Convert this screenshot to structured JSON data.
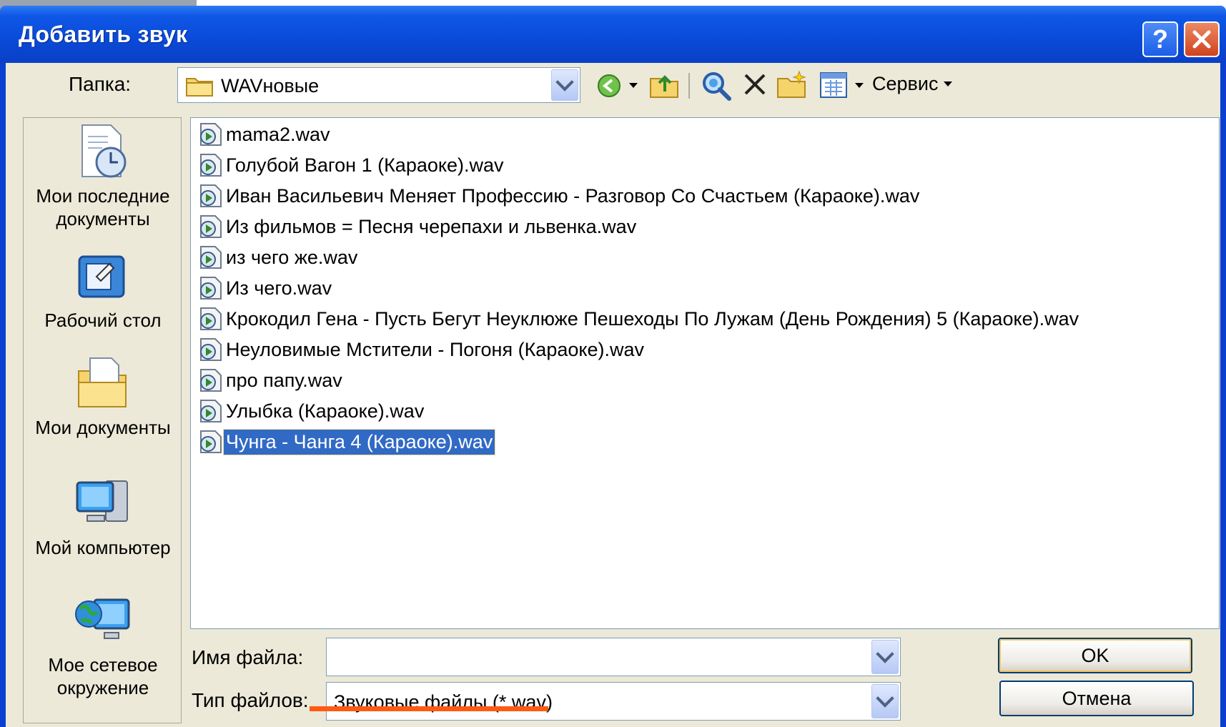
{
  "dialog": {
    "title": "Добавить звук",
    "help_label": "?",
    "close_label": "✕"
  },
  "folder": {
    "label": "Папка:",
    "value": "WAVновые"
  },
  "toolbar": {
    "service_label": "Сервис",
    "icons": [
      "back-icon",
      "up-folder-icon",
      "search-web-icon",
      "delete-icon",
      "new-folder-icon",
      "view-menu-icon"
    ]
  },
  "places": [
    {
      "label": "Мои последние документы",
      "icon": "recent-documents-icon"
    },
    {
      "label": "Рабочий стол",
      "icon": "desktop-icon"
    },
    {
      "label": "Мои документы",
      "icon": "my-documents-icon"
    },
    {
      "label": "Мой компьютер",
      "icon": "my-computer-icon"
    },
    {
      "label": "Мое сетевое окружение",
      "icon": "network-places-icon"
    }
  ],
  "files": [
    "mama2.wav",
    "Голубой Вагон 1 (Караоке).wav",
    "Иван Васильевич Меняет Профессию - Разговор Со Счастьем (Караоке).wav",
    "Из фильмов = Песня черепахи и львенка.wav",
    "из чего же.wav",
    "Из чего.wav",
    "Крокодил Гена - Пусть Бегут Неуклюже Пешеходы По Лужам (День Рождения) 5 (Караоке).wav",
    "Неуловимые Мстители - Погоня (Караоке).wav",
    "про папу.wav",
    "Улыбка (Караоке).wav",
    "Чунга - Чанга 4 (Караоке).wav"
  ],
  "selected_file_index": 10,
  "filename": {
    "label": "Имя файла:",
    "value": ""
  },
  "filetype": {
    "label": "Тип файлов:",
    "value": "Звуковые файлы (*.wav)"
  },
  "buttons": {
    "ok": "OK",
    "cancel": "Отмена"
  },
  "colors": {
    "title_bar": "#0a4ad8",
    "selection": "#316ac5",
    "dialog_face": "#ece9d8",
    "annotation_underline": "#ff5a14"
  }
}
